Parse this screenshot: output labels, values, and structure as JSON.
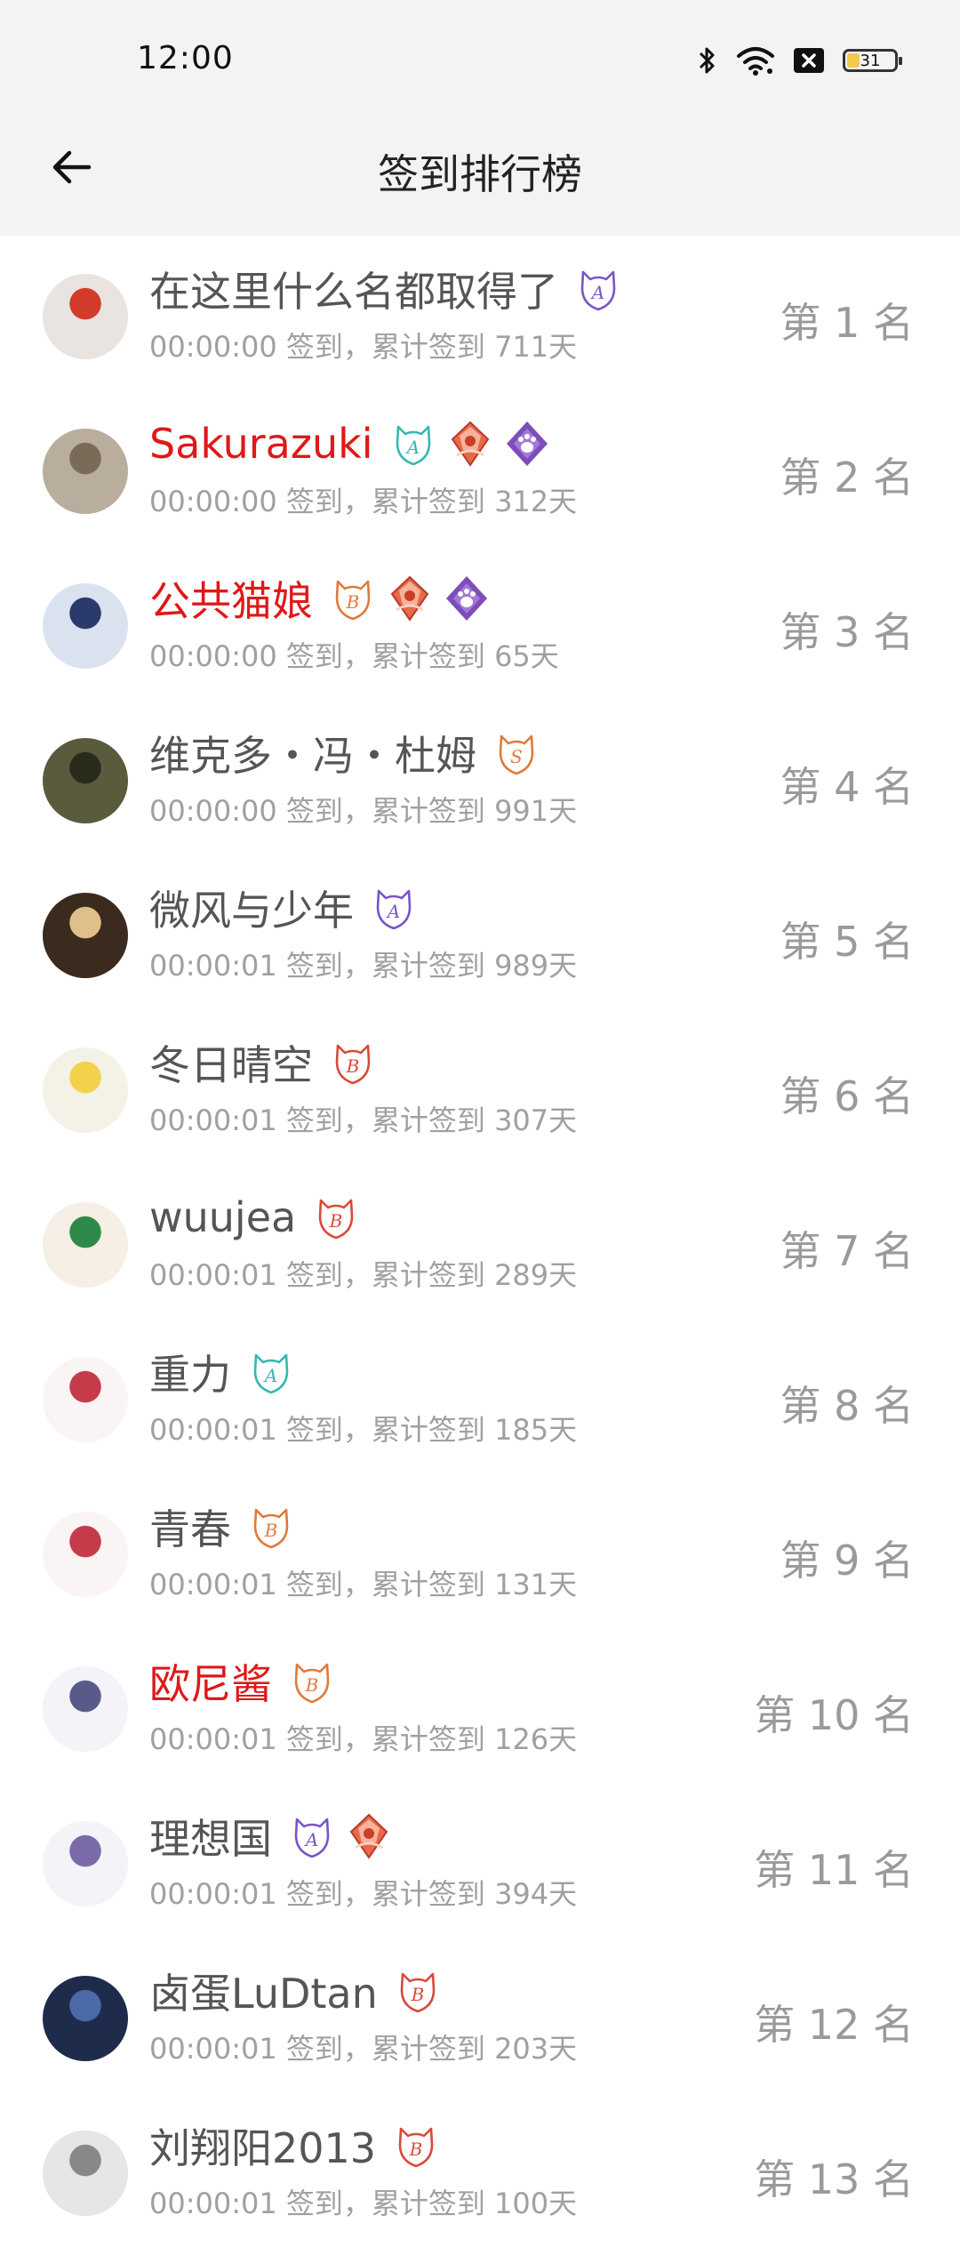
{
  "status_bar": {
    "time": "12:00",
    "battery": "31"
  },
  "header": {
    "title": "签到排行榜"
  },
  "rows": [
    {
      "name": "在这里什么名都取得了",
      "red": false,
      "sub": "00:00:00 签到，累计签到 711天",
      "rank": "第 1 名",
      "badges": [
        "cat-a-purple"
      ],
      "avatar": [
        "#e9e4df",
        "#d23a2a"
      ]
    },
    {
      "name": "Sakurazuki",
      "red": true,
      "sub": "00:00:00 签到，累计签到 312天",
      "rank": "第 2 名",
      "badges": [
        "cat-a-teal",
        "crest-red",
        "paw-purple"
      ],
      "avatar": [
        "#b9ad9e",
        "#7a6a58"
      ]
    },
    {
      "name": "公共猫娘",
      "red": true,
      "sub": "00:00:00 签到，累计签到 65天",
      "rank": "第 3 名",
      "badges": [
        "cat-b-orange",
        "crest-red",
        "paw-purple"
      ],
      "avatar": [
        "#dbe2ef",
        "#2a3b6b"
      ]
    },
    {
      "name": "维克多・冯・杜姆",
      "red": false,
      "sub": "00:00:00 签到，累计签到 991天",
      "rank": "第 4 名",
      "badges": [
        "cat-s-orange"
      ],
      "avatar": [
        "#5a5b3c",
        "#2a2a1c"
      ]
    },
    {
      "name": "微风与少年",
      "red": false,
      "sub": "00:00:01 签到，累计签到 989天",
      "rank": "第 5 名",
      "badges": [
        "cat-a-purple"
      ],
      "avatar": [
        "#3b2a1e",
        "#e0c08a"
      ]
    },
    {
      "name": "冬日晴空",
      "red": false,
      "sub": "00:00:01 签到，累计签到 307天",
      "rank": "第 6 名",
      "badges": [
        "cat-b-red"
      ],
      "avatar": [
        "#f4f1e6",
        "#f1d24a"
      ]
    },
    {
      "name": "wuujea",
      "red": false,
      "sub": "00:00:01 签到，累计签到 289天",
      "rank": "第 7 名",
      "badges": [
        "cat-b-red"
      ],
      "avatar": [
        "#f5efe6",
        "#2e8a4a"
      ]
    },
    {
      "name": "重力",
      "red": false,
      "sub": "00:00:01 签到，累计签到 185天",
      "rank": "第 8 名",
      "badges": [
        "cat-a-teal"
      ],
      "avatar": [
        "#fbf4f4",
        "#c63b4a"
      ]
    },
    {
      "name": "青春",
      "red": false,
      "sub": "00:00:01 签到，累计签到 131天",
      "rank": "第 9 名",
      "badges": [
        "cat-b-orange"
      ],
      "avatar": [
        "#fbf4f4",
        "#c63b4a"
      ]
    },
    {
      "name": "欧尼酱",
      "red": true,
      "sub": "00:00:01 签到，累计签到 126天",
      "rank": "第 10 名",
      "badges": [
        "cat-b-orange"
      ],
      "avatar": [
        "#f3f3f8",
        "#5a5a8a"
      ]
    },
    {
      "name": "理想国",
      "red": false,
      "sub": "00:00:01 签到，累计签到 394天",
      "rank": "第 11 名",
      "badges": [
        "cat-a-purple",
        "crest-red"
      ],
      "avatar": [
        "#f3f3f8",
        "#7a6aa8"
      ]
    },
    {
      "name": "卤蛋LuDtan",
      "red": false,
      "sub": "00:00:01 签到，累计签到 203天",
      "rank": "第 12 名",
      "badges": [
        "cat-b-red"
      ],
      "avatar": [
        "#1f2b4a",
        "#4a6aa8"
      ]
    },
    {
      "name": "刘翔阳2013",
      "red": false,
      "sub": "00:00:01 签到，累计签到 100天",
      "rank": "第 13 名",
      "badges": [
        "cat-b-red"
      ],
      "avatar": [
        "#e6e6e6",
        "#888888"
      ]
    }
  ]
}
